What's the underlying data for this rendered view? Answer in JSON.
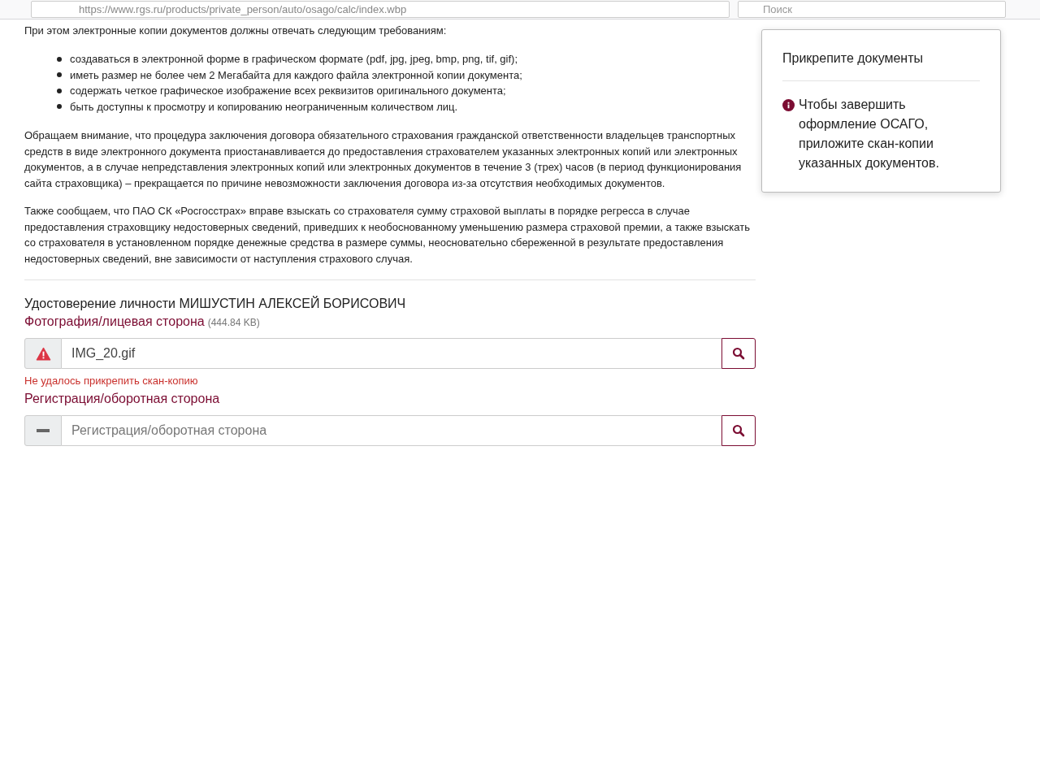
{
  "browser": {
    "url": "https://www.rgs.ru/products/private_person/auto/osago/calc/index.wbp",
    "search_placeholder": "Поиск"
  },
  "intro": "При этом электронные копии документов должны отвечать следующим требованиям:",
  "requirements": [
    "создаваться в электронной форме в графическом формате (pdf, jpg, jpeg, bmp, png, tif, gif);",
    "иметь размер не более чем 2 Мегабайта для каждого файла электронной копии документа;",
    "содержать четкое графическое изображение всех реквизитов оригинального документа;",
    "быть доступны к просмотру и копированию неограниченным количеством лиц."
  ],
  "paragraphs": [
    "Обращаем внимание, что процедура заключения договора обязательного страхования гражданской ответственности владельцев транспортных средств в виде электронного документа приостанавливается до предоставления страхователем указанных электронных копий или электронных документов, а в случае непредставления электронных копий или электронных документов в течение 3 (трех) часов (в период функционирования сайта страховщика) – прекращается по причине невозможности заключения договора из-за отсутствия необходимых документов.",
    "Также сообщаем, что ПАО СК «Росгосстрах» вправе взыскать со страхователя сумму страховой выплаты в порядке регресса в случае предоставления страховщику недостоверных сведений, приведших к необоснованному уменьшению размера страховой премии, а также взыскать со страхователя в установленном порядке денежные средства в размере суммы, неосновательно сбереженной в результате предоставления недостоверных сведений, вне зависимости от наступления страхового случая."
  ],
  "document_title": "Удостоверение личности МИШУСТИН АЛЕКСЕЙ БОРИСОВИЧ",
  "uploads": [
    {
      "label": "Фотография/лицевая сторона",
      "size": "(444.84 KB)",
      "kind": "error",
      "value": "IMG_20.gif",
      "error": "Не удалось прикрепить скан-копию"
    },
    {
      "label": "Регистрация/оборотная сторона",
      "kind": "empty",
      "placeholder": "Регистрация/оборотная сторона"
    }
  ],
  "panel": {
    "title": "Прикрепите документы",
    "message": "Чтобы завершить оформление ОСАГО, приложите скан-копии указанных документов."
  }
}
